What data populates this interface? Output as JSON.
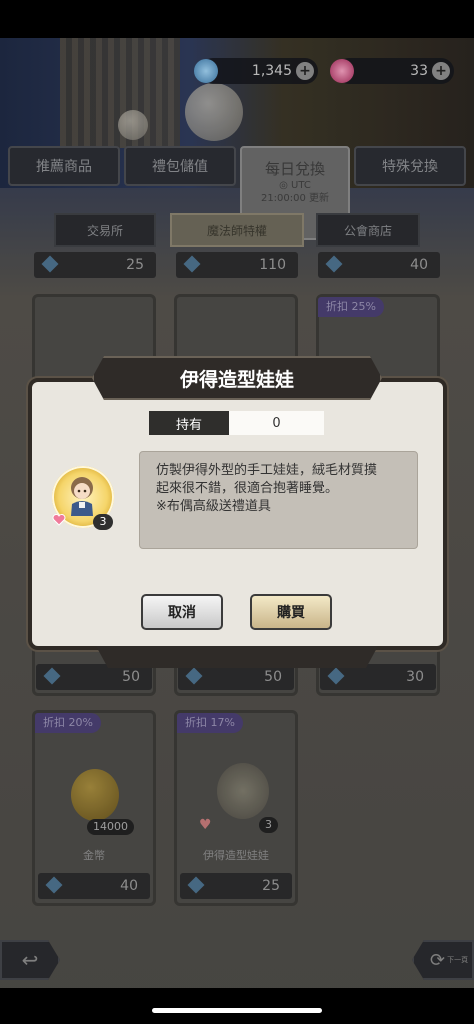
{
  "currency": {
    "gems": "1,345",
    "tickets": "33"
  },
  "tabs": [
    {
      "label": "推薦商品"
    },
    {
      "label": "禮包儲值"
    },
    {
      "label": "每日兌換",
      "sub1": "◎ UTC",
      "sub2": "21:00:00 更新"
    },
    {
      "label": "特殊兌換"
    }
  ],
  "subtabs": [
    {
      "label": "交易所"
    },
    {
      "label": "魔法師特權"
    },
    {
      "label": "公會商店"
    }
  ],
  "grid": {
    "row0_prices": [
      "25",
      "110",
      "40"
    ],
    "row1_discount": "折扣 25%",
    "row2_prices": [
      "50",
      "50",
      "30"
    ],
    "item_gold": {
      "discount": "折扣 20%",
      "amount": "14000",
      "name": "金幣",
      "price": "40"
    },
    "item_doll": {
      "discount": "折扣 17%",
      "count": "3",
      "name": "伊得造型娃娃",
      "price": "25"
    }
  },
  "edge_right_label": "下一頁",
  "dialog": {
    "title": "伊得造型娃娃",
    "owned_label": "持有",
    "owned_value": "0",
    "description": "仿製伊得外型的手工娃娃，絨毛材質摸\n起來很不錯，很適合抱著睡覺。\n※布偶高級送禮道具",
    "quantity": "3",
    "cancel": "取消",
    "buy": "購買"
  },
  "colors": {
    "gem": "#5a8fb8",
    "ticket": "#d4497a",
    "discount": "#4a3f72"
  }
}
